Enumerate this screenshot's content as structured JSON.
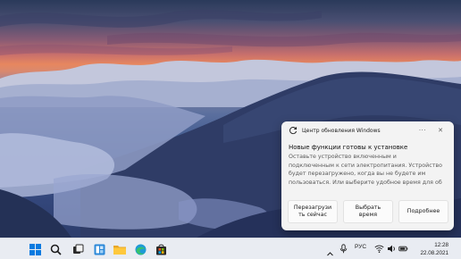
{
  "notification": {
    "app_name": "Центр обновления Windows",
    "more_symbol": "···",
    "close_symbol": "✕",
    "title": "Новые функции готовы к установке",
    "body_lines": [
      "Оставьте устройство включенным и",
      "подключенным к сети электропитания. Устройство",
      "будет перезагружено, когда вы не будете им",
      "пользоваться. Или выберите удобное время для об"
    ],
    "buttons": [
      {
        "line1": "Перезагрузи",
        "line2": "ть сейчас"
      },
      {
        "line1": "Выбрать",
        "line2": "время"
      },
      {
        "line1": "Подробнее",
        "line2": ""
      }
    ]
  },
  "taskbar": {
    "pinned_icons": [
      "windows-start-icon",
      "search-icon",
      "task-view-icon",
      "widgets-icon",
      "file-explorer-icon",
      "edge-browser-icon",
      "microsoft-store-icon"
    ],
    "language": "РУС",
    "time": "12:28",
    "date": "22.08.2021"
  },
  "colors": {
    "accent": "#0078d4",
    "toast_background": "#f3f3f3",
    "taskbar_background": "#e9ecf2"
  }
}
